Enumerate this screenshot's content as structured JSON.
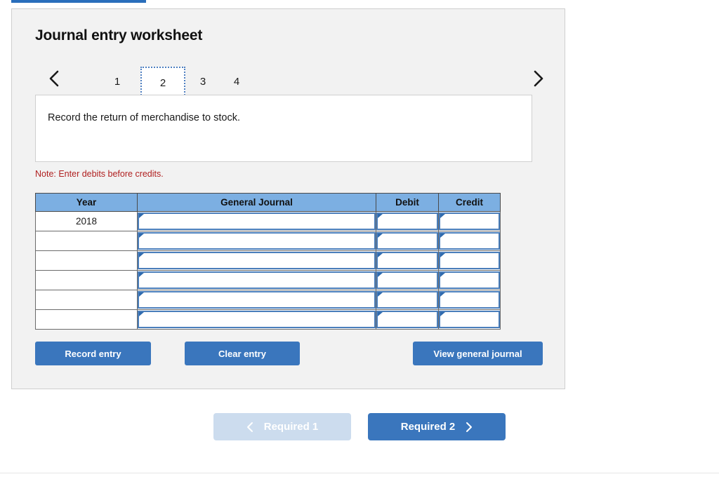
{
  "panel": {
    "title": "Journal entry worksheet",
    "description": "Record the return of merchandise to stock.",
    "note": "Note: Enter debits before credits."
  },
  "tabs": {
    "prev_icon": "chevron-left-icon",
    "next_icon": "chevron-right-icon",
    "items": [
      {
        "label": "1",
        "selected": false
      },
      {
        "label": "2",
        "selected": true
      },
      {
        "label": "3",
        "selected": false
      },
      {
        "label": "4",
        "selected": false
      }
    ]
  },
  "table": {
    "headers": {
      "year": "Year",
      "general_journal": "General Journal",
      "debit": "Debit",
      "credit": "Credit"
    },
    "rows": [
      {
        "year": "2018",
        "general_journal": "",
        "debit": "",
        "credit": ""
      },
      {
        "year": "",
        "general_journal": "",
        "debit": "",
        "credit": ""
      },
      {
        "year": "",
        "general_journal": "",
        "debit": "",
        "credit": ""
      },
      {
        "year": "",
        "general_journal": "",
        "debit": "",
        "credit": ""
      },
      {
        "year": "",
        "general_journal": "",
        "debit": "",
        "credit": ""
      },
      {
        "year": "",
        "general_journal": "",
        "debit": "",
        "credit": ""
      }
    ]
  },
  "actions": {
    "record_entry": "Record entry",
    "clear_entry": "Clear entry",
    "view_general_journal": "View general journal"
  },
  "navigation": {
    "prev_label": "Required 1",
    "prev_icon": "chevron-left-icon",
    "prev_disabled": true,
    "next_label": "Required 2",
    "next_icon": "chevron-right-icon"
  },
  "colors": {
    "accent_blue": "#3a76bd",
    "header_blue": "#7cafe2",
    "input_border_blue": "#4a7ebb",
    "disabled_blue": "#ccdcee",
    "note_red": "#b02020",
    "panel_bg": "#f2f2f2"
  }
}
